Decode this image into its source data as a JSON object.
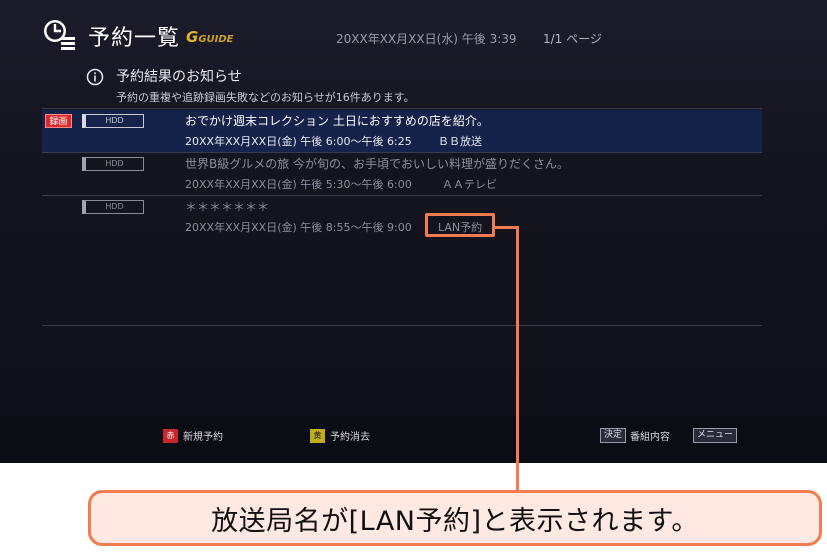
{
  "header": {
    "title": "予約一覧",
    "logo_text": "GUIDE",
    "logo_letter": "G",
    "datetime": "20XX年XX月XX日(水) 午後 3:39",
    "page_counter": "1/1 ページ"
  },
  "notice": {
    "title": "予約結果のお知らせ",
    "text": "予約の重複や追跡録画失敗などのお知らせが16件あります。"
  },
  "reservations": [
    {
      "rec_badge": "録画",
      "device": "HDD",
      "title": "おでかけ週末コレクション 土日におすすめの店を紹介。",
      "time": "20XX年XX月XX日(金) 午後 6:00～午後 6:25",
      "station": "ＢＢ放送"
    },
    {
      "device": "HDD",
      "title": "世界B級グルメの旅 今が旬の、お手頃でおいしい料理が盛りだくさん。",
      "time": "20XX年XX月XX日(金) 午後 5:30～午後 6:00",
      "station": "ＡＡテレビ"
    },
    {
      "device": "HDD",
      "title": "＊＊＊＊＊＊＊",
      "time": "20XX年XX月XX日(金) 午後 8:55～午後 9:00",
      "station": "LAN予約"
    }
  ],
  "footer": {
    "red_key": "赤",
    "red_label": "新規予約",
    "yellow_key": "黄",
    "yellow_label": "予約消去",
    "enter_key": "決定",
    "enter_label": "番組内容",
    "menu_key": "メニュー"
  },
  "caption": "放送局名が[LAN予約]と表示されます。",
  "colors": {
    "screen_bg": "#14141f",
    "selected_row": "#15234a",
    "highlight": "#f27c50",
    "caption_bg": "#fde9e1",
    "record_red": "#d92b2b"
  }
}
